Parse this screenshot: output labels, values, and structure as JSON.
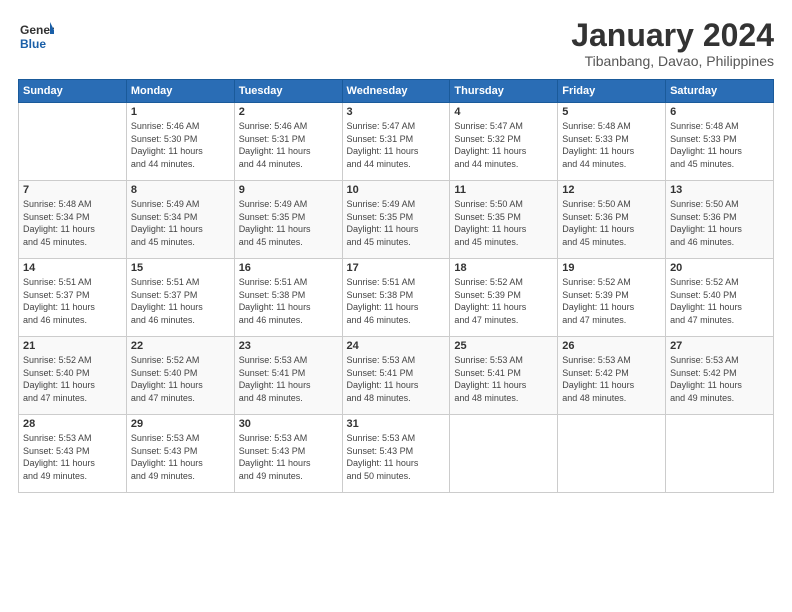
{
  "header": {
    "logo_line1": "General",
    "logo_line2": "Blue",
    "main_title": "January 2024",
    "subtitle": "Tibanbang, Davao, Philippines"
  },
  "days_of_week": [
    "Sunday",
    "Monday",
    "Tuesday",
    "Wednesday",
    "Thursday",
    "Friday",
    "Saturday"
  ],
  "weeks": [
    [
      {
        "day": "",
        "info": ""
      },
      {
        "day": "1",
        "info": "Sunrise: 5:46 AM\nSunset: 5:30 PM\nDaylight: 11 hours\nand 44 minutes."
      },
      {
        "day": "2",
        "info": "Sunrise: 5:46 AM\nSunset: 5:31 PM\nDaylight: 11 hours\nand 44 minutes."
      },
      {
        "day": "3",
        "info": "Sunrise: 5:47 AM\nSunset: 5:31 PM\nDaylight: 11 hours\nand 44 minutes."
      },
      {
        "day": "4",
        "info": "Sunrise: 5:47 AM\nSunset: 5:32 PM\nDaylight: 11 hours\nand 44 minutes."
      },
      {
        "day": "5",
        "info": "Sunrise: 5:48 AM\nSunset: 5:33 PM\nDaylight: 11 hours\nand 44 minutes."
      },
      {
        "day": "6",
        "info": "Sunrise: 5:48 AM\nSunset: 5:33 PM\nDaylight: 11 hours\nand 45 minutes."
      }
    ],
    [
      {
        "day": "7",
        "info": "Sunrise: 5:48 AM\nSunset: 5:34 PM\nDaylight: 11 hours\nand 45 minutes."
      },
      {
        "day": "8",
        "info": "Sunrise: 5:49 AM\nSunset: 5:34 PM\nDaylight: 11 hours\nand 45 minutes."
      },
      {
        "day": "9",
        "info": "Sunrise: 5:49 AM\nSunset: 5:35 PM\nDaylight: 11 hours\nand 45 minutes."
      },
      {
        "day": "10",
        "info": "Sunrise: 5:49 AM\nSunset: 5:35 PM\nDaylight: 11 hours\nand 45 minutes."
      },
      {
        "day": "11",
        "info": "Sunrise: 5:50 AM\nSunset: 5:35 PM\nDaylight: 11 hours\nand 45 minutes."
      },
      {
        "day": "12",
        "info": "Sunrise: 5:50 AM\nSunset: 5:36 PM\nDaylight: 11 hours\nand 45 minutes."
      },
      {
        "day": "13",
        "info": "Sunrise: 5:50 AM\nSunset: 5:36 PM\nDaylight: 11 hours\nand 46 minutes."
      }
    ],
    [
      {
        "day": "14",
        "info": "Sunrise: 5:51 AM\nSunset: 5:37 PM\nDaylight: 11 hours\nand 46 minutes."
      },
      {
        "day": "15",
        "info": "Sunrise: 5:51 AM\nSunset: 5:37 PM\nDaylight: 11 hours\nand 46 minutes."
      },
      {
        "day": "16",
        "info": "Sunrise: 5:51 AM\nSunset: 5:38 PM\nDaylight: 11 hours\nand 46 minutes."
      },
      {
        "day": "17",
        "info": "Sunrise: 5:51 AM\nSunset: 5:38 PM\nDaylight: 11 hours\nand 46 minutes."
      },
      {
        "day": "18",
        "info": "Sunrise: 5:52 AM\nSunset: 5:39 PM\nDaylight: 11 hours\nand 47 minutes."
      },
      {
        "day": "19",
        "info": "Sunrise: 5:52 AM\nSunset: 5:39 PM\nDaylight: 11 hours\nand 47 minutes."
      },
      {
        "day": "20",
        "info": "Sunrise: 5:52 AM\nSunset: 5:40 PM\nDaylight: 11 hours\nand 47 minutes."
      }
    ],
    [
      {
        "day": "21",
        "info": "Sunrise: 5:52 AM\nSunset: 5:40 PM\nDaylight: 11 hours\nand 47 minutes."
      },
      {
        "day": "22",
        "info": "Sunrise: 5:52 AM\nSunset: 5:40 PM\nDaylight: 11 hours\nand 47 minutes."
      },
      {
        "day": "23",
        "info": "Sunrise: 5:53 AM\nSunset: 5:41 PM\nDaylight: 11 hours\nand 48 minutes."
      },
      {
        "day": "24",
        "info": "Sunrise: 5:53 AM\nSunset: 5:41 PM\nDaylight: 11 hours\nand 48 minutes."
      },
      {
        "day": "25",
        "info": "Sunrise: 5:53 AM\nSunset: 5:41 PM\nDaylight: 11 hours\nand 48 minutes."
      },
      {
        "day": "26",
        "info": "Sunrise: 5:53 AM\nSunset: 5:42 PM\nDaylight: 11 hours\nand 48 minutes."
      },
      {
        "day": "27",
        "info": "Sunrise: 5:53 AM\nSunset: 5:42 PM\nDaylight: 11 hours\nand 49 minutes."
      }
    ],
    [
      {
        "day": "28",
        "info": "Sunrise: 5:53 AM\nSunset: 5:43 PM\nDaylight: 11 hours\nand 49 minutes."
      },
      {
        "day": "29",
        "info": "Sunrise: 5:53 AM\nSunset: 5:43 PM\nDaylight: 11 hours\nand 49 minutes."
      },
      {
        "day": "30",
        "info": "Sunrise: 5:53 AM\nSunset: 5:43 PM\nDaylight: 11 hours\nand 49 minutes."
      },
      {
        "day": "31",
        "info": "Sunrise: 5:53 AM\nSunset: 5:43 PM\nDaylight: 11 hours\nand 50 minutes."
      },
      {
        "day": "",
        "info": ""
      },
      {
        "day": "",
        "info": ""
      },
      {
        "day": "",
        "info": ""
      }
    ]
  ]
}
